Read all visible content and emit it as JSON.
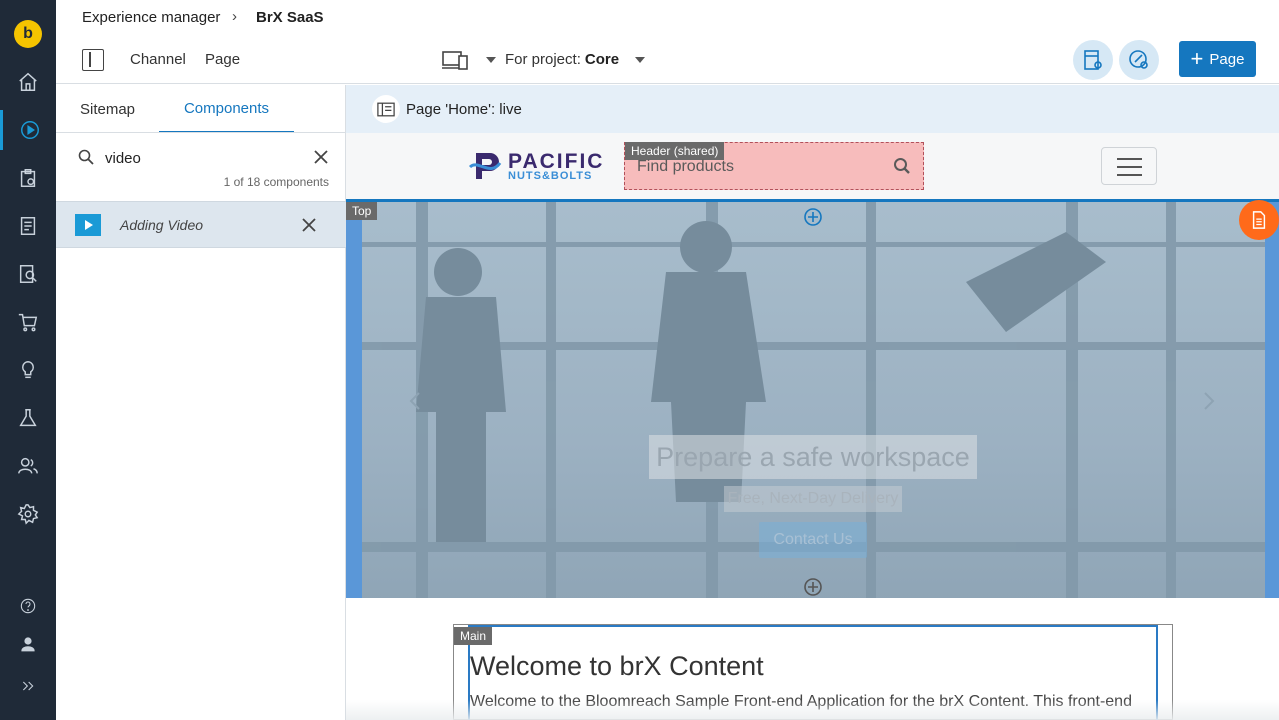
{
  "breadcrumb": {
    "root": "Experience manager",
    "current": "BrX SaaS"
  },
  "toolbar": {
    "channel_label": "Channel",
    "page_label": "Page",
    "project_prefix": "For project:",
    "project_name": "Core",
    "add_page_label": "Page"
  },
  "sidebar_nav": {
    "items": [
      "home-icon",
      "experience-manager-icon",
      "projects-icon",
      "content-icon",
      "search-content-icon",
      "commerce-icon",
      "insights-icon",
      "experiments-icon",
      "audiences-icon",
      "settings-icon",
      "help-icon",
      "user-icon",
      "expand-icon"
    ]
  },
  "panel": {
    "tabs": [
      "Sitemap",
      "Components"
    ],
    "search_value": "video",
    "result_count": "1 of 18 components",
    "results": [
      {
        "label": "Adding Video"
      }
    ]
  },
  "preview": {
    "page_status": "Page 'Home': live",
    "header_container_tag": "Header (shared)",
    "search_placeholder": "Find products",
    "logo_word1": "PACIFIC",
    "logo_word2": "NUTS&BOLTS",
    "top_container_tag": "Top",
    "hero_headline": "Prepare a safe workspace",
    "hero_subtitle": "Free, Next-Day Delivery",
    "hero_cta": "Contact Us",
    "main_container_tag": "Main",
    "main_title": "Welcome to brX Content",
    "main_text": "Welcome to the Bloomreach Sample Front-end Application for the brX Content. This front-end"
  },
  "colors": {
    "accent": "#1577bf",
    "rail": "#1f2a38",
    "fab": "#ff6a1a"
  }
}
